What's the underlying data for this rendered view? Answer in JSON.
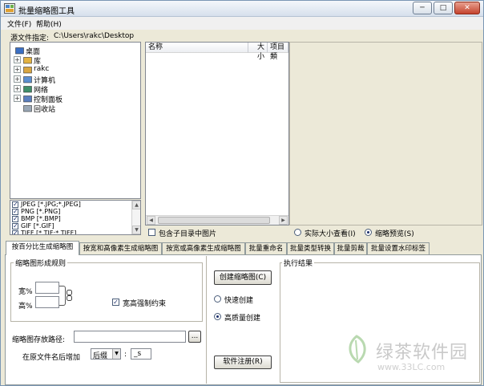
{
  "window": {
    "title": "批量缩略图工具",
    "controls": [
      "─",
      "□",
      "✕"
    ]
  },
  "menu": [
    "文件(F)",
    "帮助(H)"
  ],
  "source": {
    "label": "源文件指定:",
    "path": "C:\\Users\\rakc\\Desktop"
  },
  "tree": [
    {
      "label": "桌面",
      "icon": "desktop-icon",
      "expand": ""
    },
    {
      "label": "库",
      "icon": "library-icon",
      "expand": "+"
    },
    {
      "label": "rakc",
      "icon": "user-folder-icon",
      "expand": "+"
    },
    {
      "label": "计算机",
      "icon": "computer-icon",
      "expand": "+"
    },
    {
      "label": "网络",
      "icon": "network-icon",
      "expand": "+"
    },
    {
      "label": "控制面板",
      "icon": "control-panel-icon",
      "expand": "+"
    },
    {
      "label": "回收站",
      "icon": "recycle-bin-icon",
      "expand": ""
    }
  ],
  "filetypes": [
    {
      "label": "JPEG [*.JPG;*.JPEG]",
      "checked": true
    },
    {
      "label": "PNG [*.PNG]",
      "checked": true
    },
    {
      "label": "BMP [*.BMP]",
      "checked": true
    },
    {
      "label": "GIF [*.GIF]",
      "checked": true
    },
    {
      "label": "TIFF [*.TIF;*.TIFF]",
      "checked": true
    }
  ],
  "filelist": {
    "columns": [
      "名称",
      "大小",
      "项目類"
    ],
    "include_subdirs": "包含子目录中图片"
  },
  "preview": {
    "options": [
      "实际大小查看(I)",
      "缩略预览(S)"
    ],
    "selected": 1
  },
  "tabs": [
    "按百分比生成缩略图",
    "按宽和高像素生成缩略图",
    "按宽或高像素生成缩略图",
    "批量重命名",
    "批量类型转换",
    "批量剪裁",
    "批量设置水印标签"
  ],
  "rules": {
    "group_title": "缩略图形成规则",
    "width_label": "宽%",
    "height_label": "高%",
    "width_value": "",
    "height_value": "",
    "lock_label": "宽高强制约束",
    "lock_checked": true,
    "save_path_label": "缩略图存放路径:",
    "save_path_value": "",
    "browse_label": "...",
    "suffix_label": "在原文件名后增加",
    "suffix_mode": "后缀",
    "suffix_value": "_s"
  },
  "actions": {
    "create": "创建缩略图(C)",
    "fast": "快速创建",
    "quality": "高质量创建",
    "selected": 1,
    "register": "软件注册(R)"
  },
  "result": {
    "title": "执行结果"
  },
  "watermark": {
    "brand": "绿茶软件园",
    "url": "www.33LC.com"
  }
}
